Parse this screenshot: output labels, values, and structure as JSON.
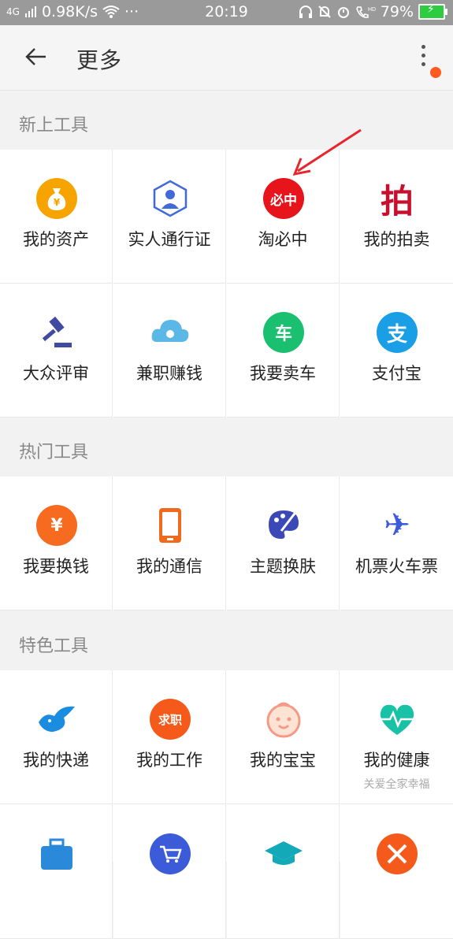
{
  "status_bar": {
    "network": "4G",
    "speed": "0.98K/s",
    "dots": "···",
    "time": "20:19",
    "battery": "79%"
  },
  "top_bar": {
    "title": "更多"
  },
  "sections": [
    {
      "title": "新上工具",
      "items": [
        {
          "label": "我的资产",
          "icon": "money-bag-icon",
          "color": "#f7a400"
        },
        {
          "label": "实人通行证",
          "icon": "identity-pass-icon",
          "color": "#3f6ad8"
        },
        {
          "label": "淘必中",
          "icon": "taobizhong-logo-icon",
          "color": "#e8141b",
          "icon_text": "必中"
        },
        {
          "label": "我的拍卖",
          "icon": "auction-pai-icon",
          "color": "#c8102e",
          "icon_text": "拍"
        },
        {
          "label": "大众评审",
          "icon": "judge-gavel-icon",
          "color": "#3f4aa0"
        },
        {
          "label": "兼职赚钱",
          "icon": "part-time-cloud-icon",
          "color": "#5bb8e6"
        },
        {
          "label": "我要卖车",
          "icon": "sell-car-icon",
          "color": "#1bbf70",
          "icon_text": "车"
        },
        {
          "label": "支付宝",
          "icon": "alipay-icon",
          "color": "#1a9ee6",
          "icon_text": "支"
        }
      ]
    },
    {
      "title": "热门工具",
      "items": [
        {
          "label": "我要换钱",
          "icon": "money-exchange-icon",
          "color": "#f66b1f",
          "icon_text": "¥"
        },
        {
          "label": "我的通信",
          "icon": "phone-icon",
          "color": "#f06a1d"
        },
        {
          "label": "主题换肤",
          "icon": "theme-palette-icon",
          "color": "#3b48b8"
        },
        {
          "label": "机票火车票",
          "icon": "airplane-icon",
          "color": "#3b5bd8",
          "icon_text": "✈"
        }
      ]
    },
    {
      "title": "特色工具",
      "items": [
        {
          "label": "我的快递",
          "icon": "delivery-bird-icon",
          "color": "#1a8de0"
        },
        {
          "label": "我的工作",
          "icon": "job-qiuzhi-icon",
          "color": "#f65a1b",
          "icon_text": "求职"
        },
        {
          "label": "我的宝宝",
          "icon": "baby-face-icon",
          "color": "#f49a86"
        },
        {
          "label": "我的健康",
          "icon": "health-heart-icon",
          "color": "#19c2a5",
          "sub": "关爱全家幸福"
        },
        {
          "label": "",
          "icon": "luggage-icon",
          "color": "#2a89d8"
        },
        {
          "label": "",
          "icon": "shopping-cart-icon",
          "color": "#3b5bd8"
        },
        {
          "label": "",
          "icon": "graduation-cap-icon",
          "color": "#14a9b8"
        },
        {
          "label": "",
          "icon": "pencil-ruler-icon",
          "color": "#f35a1b"
        }
      ]
    }
  ]
}
